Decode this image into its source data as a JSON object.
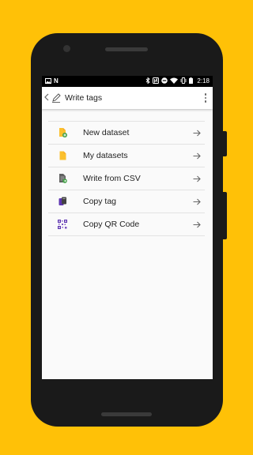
{
  "status_bar": {
    "time": "2:18",
    "left_icons": [
      "image-icon",
      "n-logo-icon"
    ],
    "right_icons": [
      "bluetooth-icon",
      "nfc-icon",
      "dnd-icon",
      "wifi-icon",
      "vibrate-icon",
      "battery-icon"
    ]
  },
  "app_bar": {
    "title": "Write tags"
  },
  "menu": {
    "items": [
      {
        "label": "New dataset",
        "icon": "file-add-icon"
      },
      {
        "label": "My datasets",
        "icon": "file-icon"
      },
      {
        "label": "Write from CSV",
        "icon": "csv-file-icon"
      },
      {
        "label": "Copy tag",
        "icon": "copy-tag-icon"
      },
      {
        "label": "Copy QR Code",
        "icon": "qr-code-icon"
      }
    ]
  },
  "colors": {
    "background": "#ffc107",
    "icon_yellow": "#fbc02d",
    "icon_green": "#43a047",
    "icon_purple": "#5e35b1"
  }
}
